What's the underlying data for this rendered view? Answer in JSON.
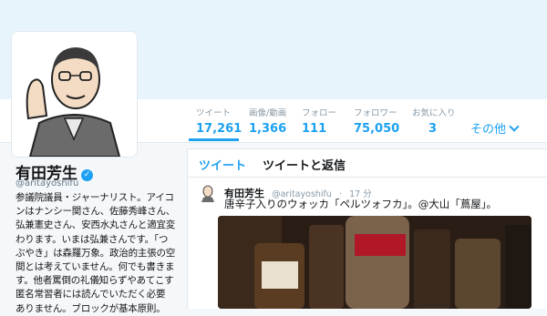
{
  "profile": {
    "name": "有田芳生",
    "handle": "@aritayoshifu",
    "bio_lines": [
      "参議院議員・ジャーナリスト。アイコ",
      "ンはナンシー関さん、佐藤秀峰さん、",
      "弘兼憲史さん、安西水丸さんと適宜変",
      "わります。いまは弘兼さんです。「つ",
      "ぶやき」は森羅万象。政治的主張の空",
      "間とは考えていません。何でも書きま",
      "す。他者罵倒の礼儀知らずやあてこすり",
      "匿名常習者には読んでいただく必要",
      "ありません。ブロックが基本原則。"
    ]
  },
  "stats": [
    {
      "label": "ツイート",
      "value": "17,261"
    },
    {
      "label": "画像/動画",
      "value": "1,366"
    },
    {
      "label": "フォロー",
      "value": "111"
    },
    {
      "label": "フォロワー",
      "value": "75,050"
    },
    {
      "label": "お気に入り",
      "value": "3"
    }
  ],
  "nav": {
    "more_label": "その他"
  },
  "timeline": {
    "tabs": [
      {
        "label": "ツイート"
      },
      {
        "label": "ツイートと返信"
      }
    ],
    "tweet": {
      "author": "有田芳生",
      "handle": "@aritayoshifu",
      "time": "17 分",
      "text": "唐辛子入りのウォッカ「ペルツォフカ」。@大山「蔦屋」。"
    }
  },
  "colors": {
    "accent": "#1da1f2",
    "background": "#f5f8fa",
    "banner": "#e8f4fb"
  },
  "icons": {
    "verified": "verified-badge-icon",
    "more_chevron": "chevron-down-icon"
  }
}
